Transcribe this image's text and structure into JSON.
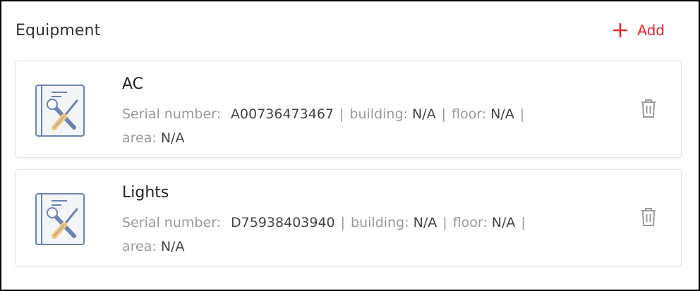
{
  "header": {
    "title": "Equipment",
    "add_label": "Add",
    "add_color": "#e6242b"
  },
  "equipment": [
    {
      "name": "AC",
      "serial_label": "Serial number:",
      "serial": "A00736473467",
      "building_label": "building:",
      "building": "N/A",
      "floor_label": "floor:",
      "floor": "N/A",
      "area_label": "area:",
      "area": "N/A",
      "icon": "equipment-tools-icon"
    },
    {
      "name": "Lights",
      "serial_label": "Serial number:",
      "serial": "D75938403940",
      "building_label": "building:",
      "building": "N/A",
      "floor_label": "floor:",
      "floor": "N/A",
      "area_label": "area:",
      "area": "N/A",
      "icon": "equipment-tools-icon"
    }
  ],
  "separator": "|",
  "icons": {
    "add": "plus-icon",
    "delete": "trash-icon"
  }
}
